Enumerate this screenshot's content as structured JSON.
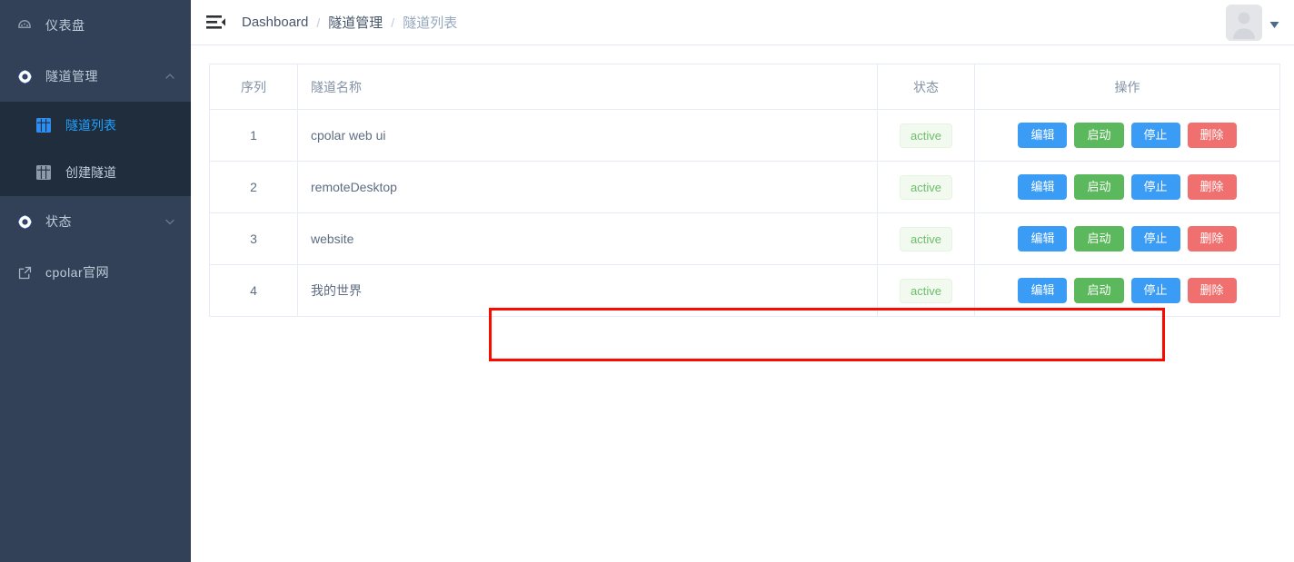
{
  "sidebar": {
    "items": [
      {
        "label": "仪表盘",
        "icon": "dashboard-icon",
        "id": "dashboard",
        "expandable": false
      },
      {
        "label": "隧道管理",
        "icon": "tunnel-manage-icon",
        "id": "tunnel-manage",
        "expandable": true,
        "chevron": "chevron-up-icon",
        "expanded": true
      },
      {
        "label": "状态",
        "icon": "status-icon",
        "id": "status",
        "expandable": true,
        "chevron": "chevron-down-icon",
        "expanded": false
      },
      {
        "label": "cpolar官网",
        "icon": "external-link-icon",
        "id": "cpolar-website",
        "expandable": false
      }
    ],
    "submenu": [
      {
        "label": "隧道列表",
        "icon": "grid-icon",
        "id": "tunnel-list",
        "active": true
      },
      {
        "label": "创建隧道",
        "icon": "grid-icon",
        "id": "create-tunnel",
        "active": false
      }
    ],
    "colors": {
      "bg": "#324157",
      "submenu_bg": "#1f2d3d",
      "text": "#bfcbd9",
      "active_text": "#20a0ff"
    }
  },
  "topbar": {
    "menu_toggle_icon": "hamburger-collapse-icon",
    "breadcrumb": [
      {
        "label": "Dashboard",
        "muted": false
      },
      {
        "label": "隧道管理",
        "muted": false
      },
      {
        "label": "隧道列表",
        "muted": true
      }
    ],
    "separator": "/",
    "avatar_icon": "user-avatar-placeholder",
    "caret_icon": "caret-down-icon"
  },
  "table": {
    "columns": [
      {
        "key": "seq",
        "label": "序列"
      },
      {
        "key": "name",
        "label": "隧道名称"
      },
      {
        "key": "state",
        "label": "状态"
      },
      {
        "key": "ops",
        "label": "操作"
      }
    ],
    "rows": [
      {
        "seq": "1",
        "name": "cpolar web ui",
        "state": "active",
        "highlighted": false
      },
      {
        "seq": "2",
        "name": "remoteDesktop",
        "state": "active",
        "highlighted": false
      },
      {
        "seq": "3",
        "name": "website",
        "state": "active",
        "highlighted": false
      },
      {
        "seq": "4",
        "name": "我的世界",
        "state": "active",
        "highlighted": true
      }
    ],
    "actions": [
      {
        "label": "编辑",
        "id": "edit",
        "color": "#3b9cf5"
      },
      {
        "label": "启动",
        "id": "start",
        "color": "#5cb85c"
      },
      {
        "label": "停止",
        "id": "stop",
        "color": "#3b9cf5"
      },
      {
        "label": "删除",
        "id": "delete",
        "color": "#f0706f"
      }
    ],
    "badge_colors": {
      "text": "#6cbf6c",
      "bg": "#f2f9ef",
      "border": "#e7f3e1"
    }
  },
  "annotation": {
    "highlight_color": "#fa0b00"
  }
}
